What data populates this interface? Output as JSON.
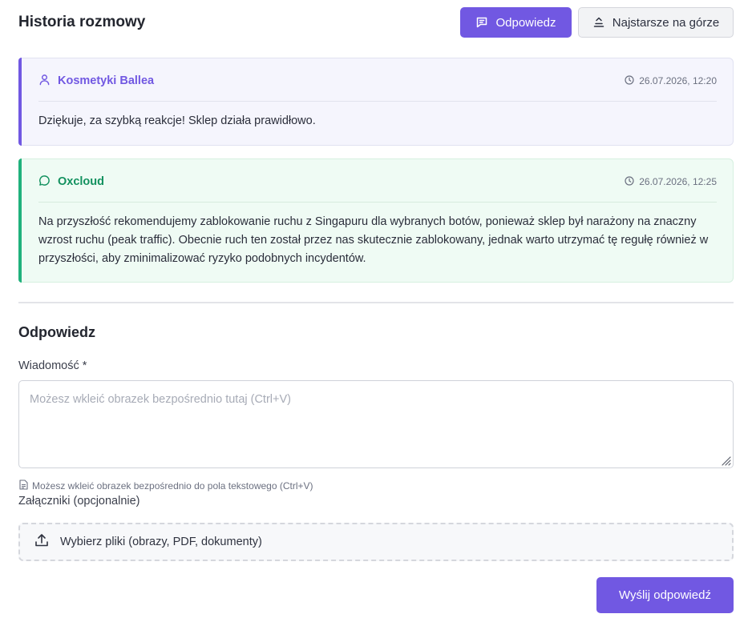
{
  "header": {
    "title": "Historia rozmowy",
    "reply_button": "Odpowiedz",
    "sort_button": "Najstarsze na górze"
  },
  "messages": [
    {
      "author": "Kosmetyki Ballea",
      "timestamp": "26.07.2026, 12:20",
      "text": "Dziękuje, za szybką reakcje! Sklep działa prawidłowo."
    },
    {
      "author": "Oxcloud",
      "timestamp": "26.07.2026, 12:25",
      "text": "Na przyszłość rekomendujemy zablokowanie ruchu z Singapuru dla wybranych botów, ponieważ sklep był narażony na znaczny wzrost ruchu (peak traffic). Obecnie ruch ten został przez nas skutecznie zablokowany, jednak warto utrzymać tę regułę również w przyszłości, aby zminimalizować ryzyko podobnych incydentów."
    }
  ],
  "reply_form": {
    "title": "Odpowiedz",
    "message_label": "Wiadomość *",
    "message_value": "",
    "message_placeholder": "Możesz wkleić obrazek bezpośrednio tutaj (Ctrl+V)",
    "paste_hint": "Możesz wkleić obrazek bezpośrednio do pola tekstowego (Ctrl+V)",
    "attachments_label": "Załączniki (opcjonalnie)",
    "file_picker_label": "Wybierz pliki (obrazy, PDF, dokumenty)",
    "submit_button": "Wyślij odpowiedź"
  },
  "colors": {
    "accent": "#7158e2",
    "customer_card_bg": "#f5f5fd",
    "support_card_bg": "#effbf4",
    "support_accent": "#20b17c"
  },
  "icons": {
    "reply": "message-square-icon",
    "sort": "sort-oldest-icon",
    "customer": "user-icon",
    "support": "chat-bubble-icon",
    "time": "clock-icon",
    "hint": "file-text-icon",
    "upload": "upload-icon"
  }
}
